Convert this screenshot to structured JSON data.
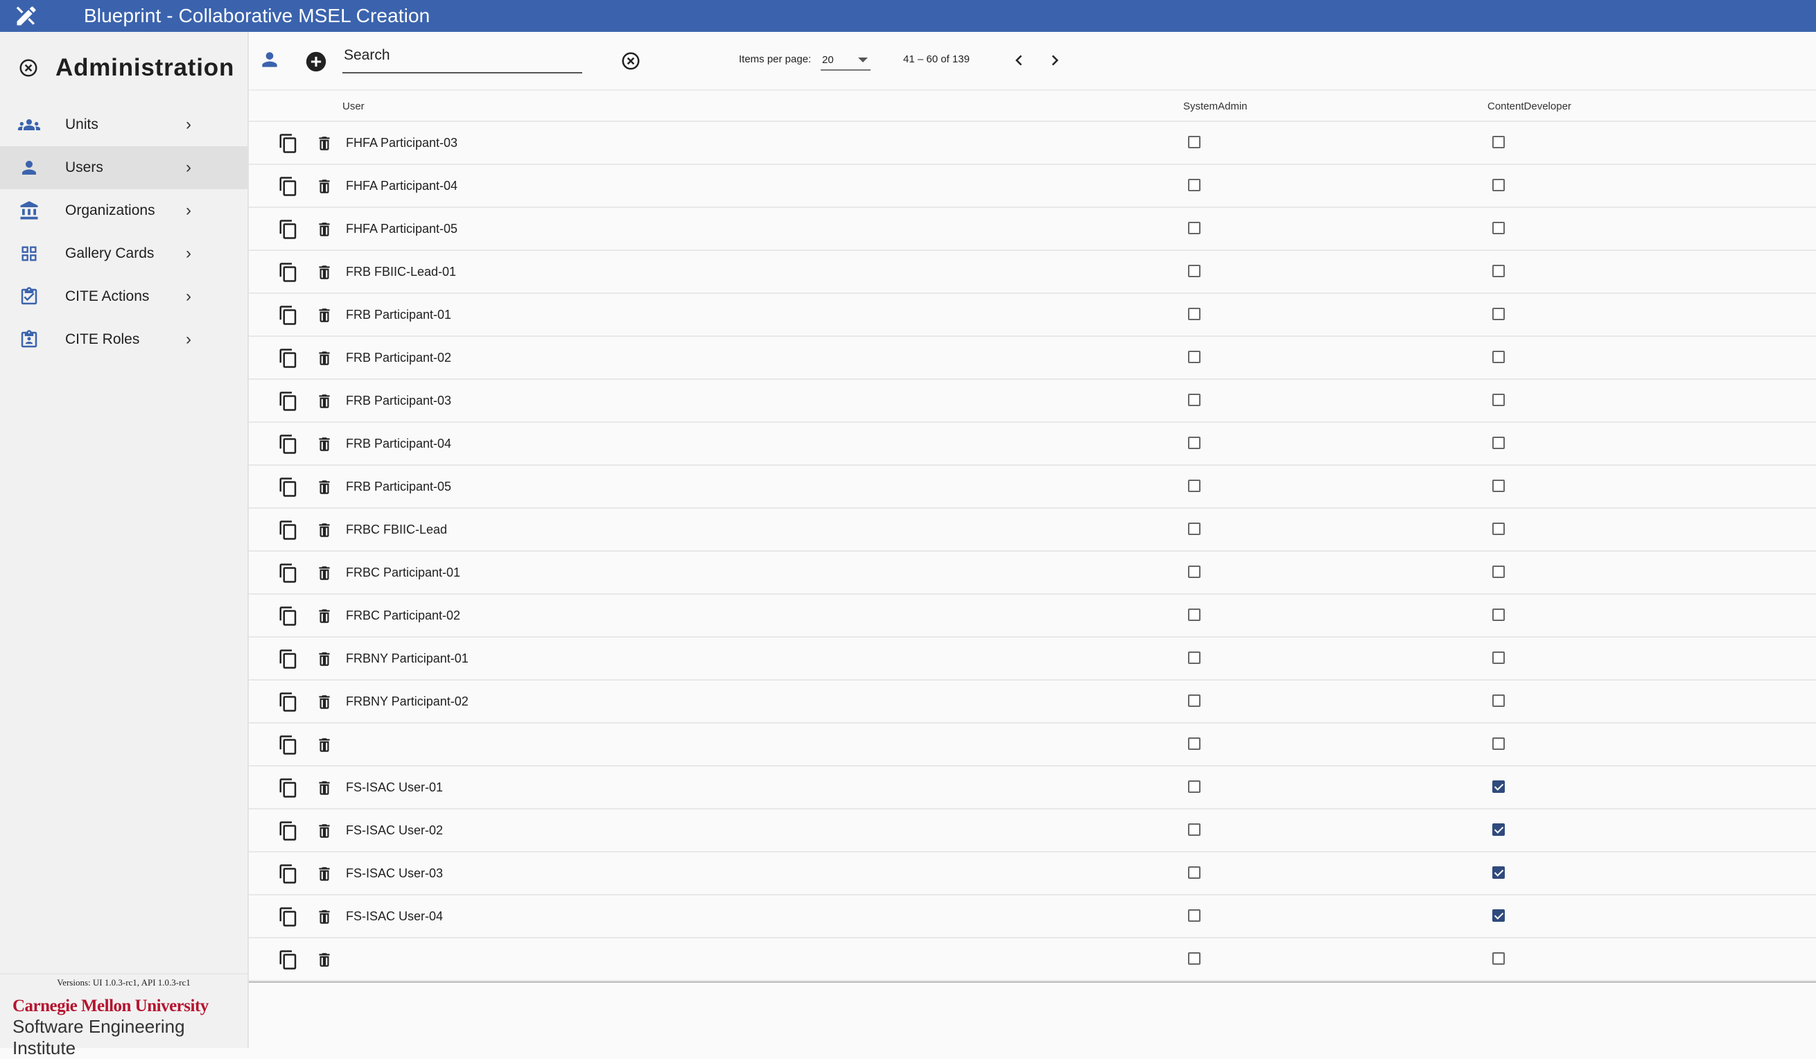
{
  "app": {
    "title": "Blueprint - Collaborative MSEL Creation",
    "logo_icon": "drafting-tools-icon"
  },
  "sidebar": {
    "heading": "Administration",
    "items": [
      {
        "label": "Units",
        "icon": "group-icon",
        "active": false
      },
      {
        "label": "Users",
        "icon": "person-icon",
        "active": true
      },
      {
        "label": "Organizations",
        "icon": "bank-icon",
        "active": false
      },
      {
        "label": "Gallery Cards",
        "icon": "grid-icon",
        "active": false
      },
      {
        "label": "CITE Actions",
        "icon": "clipboard-check-icon",
        "active": false
      },
      {
        "label": "CITE Roles",
        "icon": "clipboard-account-icon",
        "active": false
      }
    ],
    "versions": "Versions: UI 1.0.3-rc1, API 1.0.3-rc1",
    "footer_org": "Carnegie Mellon University",
    "footer_sub": "Software Engineering Institute"
  },
  "toolbar": {
    "search_placeholder": "Search",
    "items_per_page_label": "Items per page:",
    "items_per_page_value": "20",
    "range_label": "41 – 60 of 139"
  },
  "table": {
    "headers": {
      "user": "User",
      "system_admin": "SystemAdmin",
      "content_developer": "ContentDeveloper"
    },
    "rows": [
      {
        "name": "FHFA Participant-03",
        "system_admin": false,
        "content_developer": false
      },
      {
        "name": "FHFA Participant-04",
        "system_admin": false,
        "content_developer": false
      },
      {
        "name": "FHFA Participant-05",
        "system_admin": false,
        "content_developer": false
      },
      {
        "name": "FRB FBIIC-Lead-01",
        "system_admin": false,
        "content_developer": false
      },
      {
        "name": "FRB Participant-01",
        "system_admin": false,
        "content_developer": false
      },
      {
        "name": "FRB Participant-02",
        "system_admin": false,
        "content_developer": false
      },
      {
        "name": "FRB Participant-03",
        "system_admin": false,
        "content_developer": false
      },
      {
        "name": "FRB Participant-04",
        "system_admin": false,
        "content_developer": false
      },
      {
        "name": "FRB Participant-05",
        "system_admin": false,
        "content_developer": false
      },
      {
        "name": "FRBC FBIIC-Lead",
        "system_admin": false,
        "content_developer": false
      },
      {
        "name": "FRBC Participant-01",
        "system_admin": false,
        "content_developer": false
      },
      {
        "name": "FRBC Participant-02",
        "system_admin": false,
        "content_developer": false
      },
      {
        "name": "FRBNY Participant-01",
        "system_admin": false,
        "content_developer": false
      },
      {
        "name": "FRBNY Participant-02",
        "system_admin": false,
        "content_developer": false
      },
      {
        "name": "",
        "system_admin": false,
        "content_developer": false
      },
      {
        "name": "FS-ISAC User-01",
        "system_admin": false,
        "content_developer": true
      },
      {
        "name": "FS-ISAC User-02",
        "system_admin": false,
        "content_developer": true
      },
      {
        "name": "FS-ISAC User-03",
        "system_admin": false,
        "content_developer": true
      },
      {
        "name": "FS-ISAC User-04",
        "system_admin": false,
        "content_developer": true
      },
      {
        "name": "",
        "system_admin": false,
        "content_developer": false
      }
    ]
  },
  "colors": {
    "topbar": "#3b63ad",
    "icon_blue": "#3b63ad",
    "checkbox_on": "#2f4a7c",
    "cmu_red": "#b5142f"
  }
}
